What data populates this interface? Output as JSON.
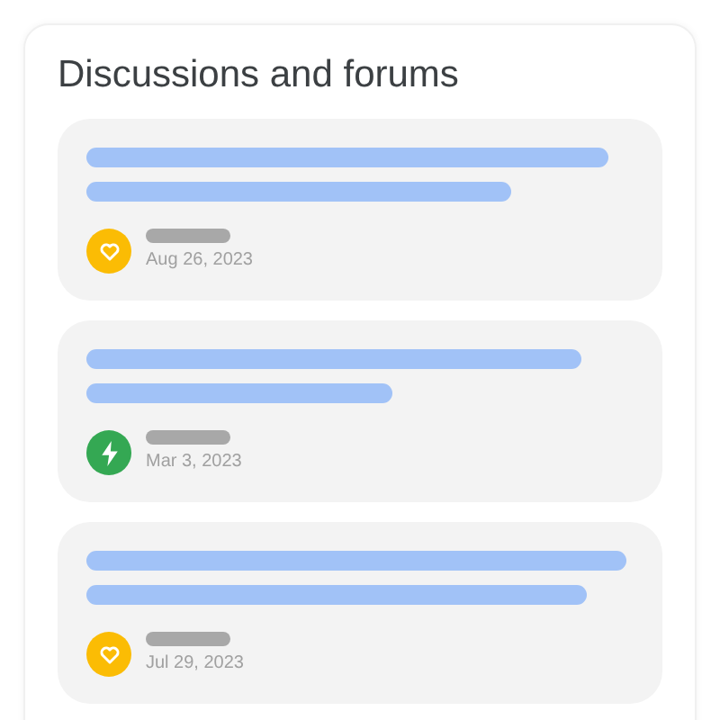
{
  "title": "Discussions and forums",
  "posts": [
    {
      "kind": "heart",
      "color": "#fbbc04",
      "date": "Aug 26, 2023"
    },
    {
      "kind": "bolt",
      "color": "#34a853",
      "date": "Mar 3, 2023"
    },
    {
      "kind": "heart",
      "color": "#fbbc04",
      "date": "Jul 29, 2023"
    }
  ]
}
